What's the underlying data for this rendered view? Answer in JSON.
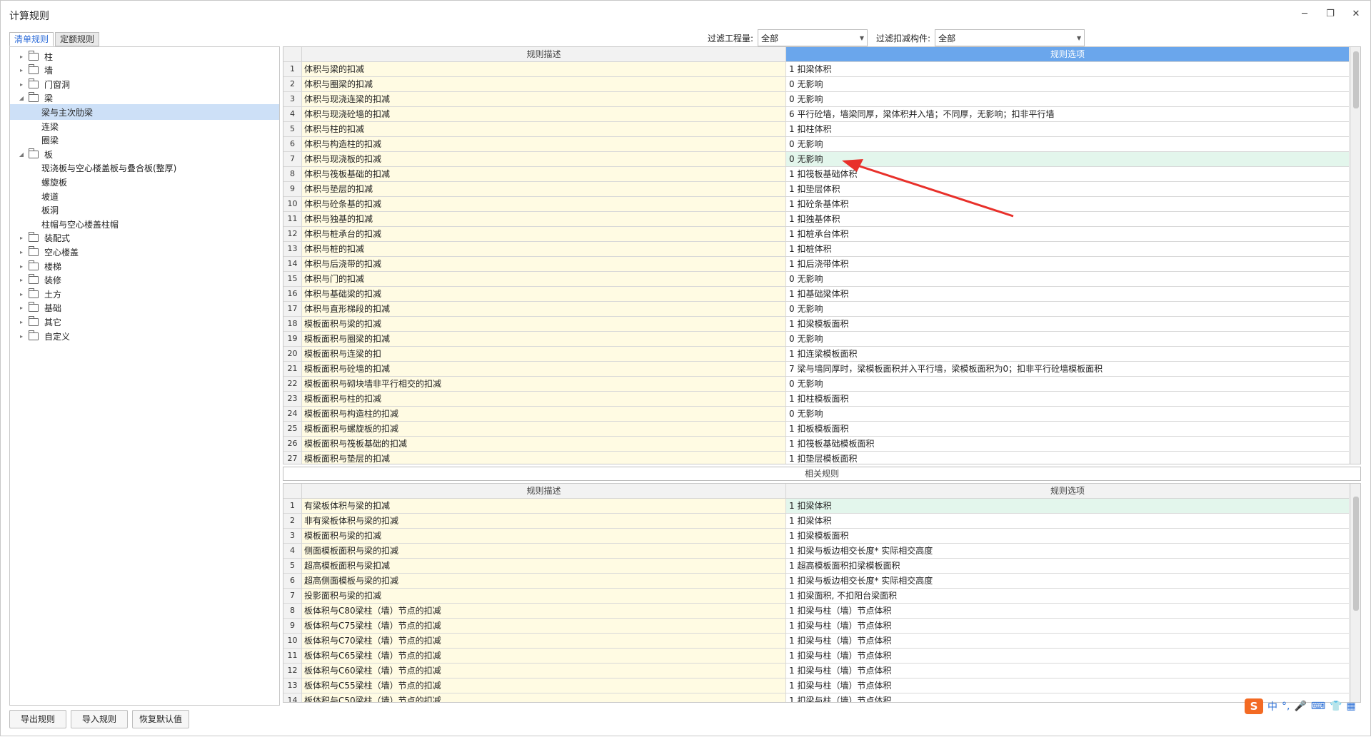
{
  "window": {
    "title": "计算规则",
    "minimize": "─",
    "restore": "❐",
    "close": "✕"
  },
  "tabs": [
    "清单规则",
    "定额规则"
  ],
  "filters": {
    "quantity_label": "过滤工程量:",
    "quantity_value": "全部",
    "component_label": "过滤扣减构件:",
    "component_value": "全部"
  },
  "tree": [
    {
      "label": "柱",
      "level": 0,
      "expanded": false,
      "folder": true
    },
    {
      "label": "墙",
      "level": 0,
      "expanded": false,
      "folder": true
    },
    {
      "label": "门窗洞",
      "level": 0,
      "expanded": false,
      "folder": true
    },
    {
      "label": "梁",
      "level": 0,
      "expanded": true,
      "folder": true
    },
    {
      "label": "梁与主次肋梁",
      "level": 1,
      "selected": true
    },
    {
      "label": "连梁",
      "level": 1
    },
    {
      "label": "圈梁",
      "level": 1
    },
    {
      "label": "板",
      "level": 0,
      "expanded": true,
      "folder": true
    },
    {
      "label": "现浇板与空心楼盖板与叠合板(整厚)",
      "level": 1
    },
    {
      "label": "螺旋板",
      "level": 1
    },
    {
      "label": "坡道",
      "level": 1
    },
    {
      "label": "板洞",
      "level": 1
    },
    {
      "label": "柱帽与空心楼盖柱帽",
      "level": 1
    },
    {
      "label": "装配式",
      "level": 0,
      "expanded": false,
      "folder": true
    },
    {
      "label": "空心楼盖",
      "level": 0,
      "expanded": false,
      "folder": true
    },
    {
      "label": "楼梯",
      "level": 0,
      "expanded": false,
      "folder": true
    },
    {
      "label": "装修",
      "level": 0,
      "expanded": false,
      "folder": true
    },
    {
      "label": "土方",
      "level": 0,
      "expanded": false,
      "folder": true
    },
    {
      "label": "基础",
      "level": 0,
      "expanded": false,
      "folder": true
    },
    {
      "label": "其它",
      "level": 0,
      "expanded": false,
      "folder": true
    },
    {
      "label": "自定义",
      "level": 0,
      "expanded": false,
      "folder": true
    }
  ],
  "upper_grid": {
    "headers": [
      "规则描述",
      "规则选项"
    ],
    "rows": [
      [
        "1",
        "体积与梁的扣减",
        "1 扣梁体积"
      ],
      [
        "2",
        "体积与圈梁的扣减",
        "0  无影响"
      ],
      [
        "3",
        "体积与现浇连梁的扣减",
        "0  无影响"
      ],
      [
        "4",
        "体积与现浇砼墙的扣减",
        "6 平行砼墙，墙梁同厚，梁体积并入墙；不同厚，无影响；扣非平行墙"
      ],
      [
        "5",
        "体积与柱的扣减",
        "1 扣柱体积"
      ],
      [
        "6",
        "体积与构造柱的扣减",
        "0  无影响"
      ],
      [
        "7",
        "体积与现浇板的扣减",
        "0  无影响"
      ],
      [
        "8",
        "体积与筏板基础的扣减",
        "1 扣筏板基础体积"
      ],
      [
        "9",
        "体积与垫层的扣减",
        "1 扣垫层体积"
      ],
      [
        "10",
        "体积与砼条基的扣减",
        "1 扣砼条基体积"
      ],
      [
        "11",
        "体积与独基的扣减",
        "1 扣独基体积"
      ],
      [
        "12",
        "体积与桩承台的扣减",
        "1 扣桩承台体积"
      ],
      [
        "13",
        "体积与桩的扣减",
        "1 扣桩体积"
      ],
      [
        "14",
        "体积与后浇带的扣减",
        "1 扣后浇带体积"
      ],
      [
        "15",
        "体积与门的扣减",
        "0  无影响"
      ],
      [
        "16",
        "体积与基础梁的扣减",
        "1 扣基础梁体积"
      ],
      [
        "17",
        "体积与直形梯段的扣减",
        "0  无影响"
      ],
      [
        "18",
        "模板面积与梁的扣减",
        "1 扣梁模板面积"
      ],
      [
        "19",
        "模板面积与圈梁的扣减",
        "0  无影响"
      ],
      [
        "20",
        "模板面积与连梁的扣",
        "1 扣连梁模板面积"
      ],
      [
        "21",
        "模板面积与砼墙的扣减",
        "7 梁与墙同厚时，梁模板面积并入平行墙，梁模板面积为0；扣非平行砼墙模板面积"
      ],
      [
        "22",
        "模板面积与砌块墙非平行相交的扣减",
        "0  无影响"
      ],
      [
        "23",
        "模板面积与柱的扣减",
        "1 扣柱模板面积"
      ],
      [
        "24",
        "模板面积与构造柱的扣减",
        "0  无影响"
      ],
      [
        "25",
        "模板面积与螺旋板的扣减",
        "1 扣板模板面积"
      ],
      [
        "26",
        "模板面积与筏板基础的扣减",
        "1 扣筏板基础模板面积"
      ],
      [
        "27",
        "模板面积与垫层的扣减",
        "1 扣垫层模板面积"
      ]
    ]
  },
  "related_label": "相关规则",
  "lower_grid": {
    "headers": [
      "规则描述",
      "规则选项"
    ],
    "rows": [
      [
        "1",
        "有梁板体积与梁的扣减",
        "1   扣梁体积"
      ],
      [
        "2",
        "非有梁板体积与梁的扣减",
        "1   扣梁体积"
      ],
      [
        "3",
        "模板面积与梁的扣减",
        "1   扣梁模板面积"
      ],
      [
        "4",
        "侧面模板面积与梁的扣减",
        "1   扣梁与板边相交长度* 实际相交高度"
      ],
      [
        "5",
        "超高模板面积与梁扣减",
        "1   超高模板面积扣梁模板面积"
      ],
      [
        "6",
        "超高侧面模板与梁的扣减",
        "1   扣梁与板边相交长度* 实际相交高度"
      ],
      [
        "7",
        "投影面积与梁的扣减",
        "1   扣梁面积, 不扣阳台梁面积"
      ],
      [
        "8",
        "板体积与C80梁柱（墙）节点的扣减",
        "1 扣梁与柱（墙）节点体积"
      ],
      [
        "9",
        "板体积与C75梁柱（墙）节点的扣减",
        "1 扣梁与柱（墙）节点体积"
      ],
      [
        "10",
        "板体积与C70梁柱（墙）节点的扣减",
        "1 扣梁与柱（墙）节点体积"
      ],
      [
        "11",
        "板体积与C65梁柱（墙）节点的扣减",
        "1 扣梁与柱（墙）节点体积"
      ],
      [
        "12",
        "板体积与C60梁柱（墙）节点的扣减",
        "1 扣梁与柱（墙）节点体积"
      ],
      [
        "13",
        "板体积与C55梁柱（墙）节点的扣减",
        "1 扣梁与柱（墙）节点体积"
      ],
      [
        "14",
        "板体积与C50梁柱（墙）节点的扣减",
        "1 扣梁与柱（墙）节点体积"
      ]
    ]
  },
  "buttons": {
    "export": "导出规则",
    "import": "导入规则",
    "restore_default": "恢复默认值"
  },
  "ime": {
    "logo": "S",
    "lang": "中",
    "punct": "°,",
    "mic": "🎤",
    "keyboard": "⌨",
    "skin": "👕",
    "grid": "▦"
  },
  "colors": {
    "header_selected": "#6aa6ec",
    "desc_bg": "#fffbe3",
    "highlight_row": "#e3f6ec",
    "tree_selected": "#cde0f7",
    "annotation_arrow": "#e8302a"
  }
}
